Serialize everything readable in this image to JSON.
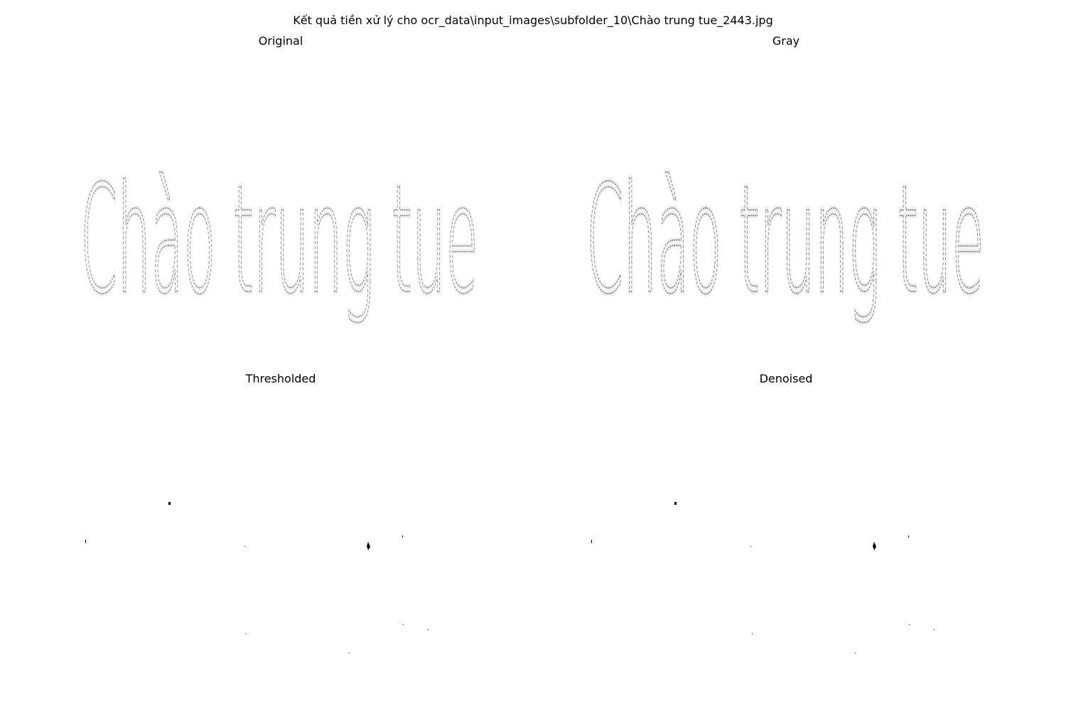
{
  "figure_title": "Kết quả tiền xử lý cho ocr_data\\input_images\\subfolder_10\\Chào trung tue_2443.jpg",
  "panels": {
    "original": {
      "title": "Original"
    },
    "gray": {
      "title": "Gray"
    },
    "thresholded": {
      "title": "Thresholded"
    },
    "denoised": {
      "title": "Denoised"
    }
  },
  "image_text": "Chào trung tue"
}
